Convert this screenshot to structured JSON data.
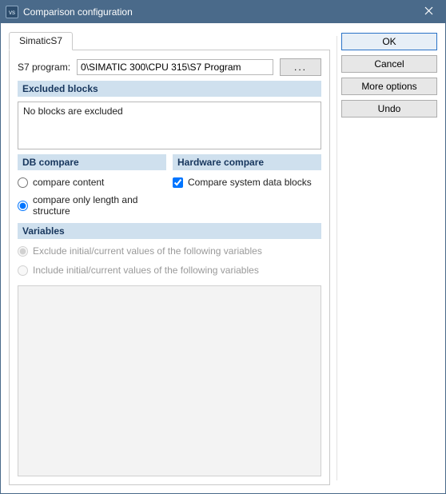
{
  "window": {
    "title": "Comparison configuration"
  },
  "buttons": {
    "ok": "OK",
    "cancel": "Cancel",
    "more_options": "More options",
    "undo": "Undo",
    "browse": "..."
  },
  "tabs": {
    "simatic": "SimaticS7"
  },
  "program": {
    "label": "S7 program:",
    "value": "0\\SIMATIC 300\\CPU 315\\S7 Program"
  },
  "sections": {
    "excluded_blocks": "Excluded blocks",
    "db_compare": "DB compare",
    "hardware_compare": "Hardware compare",
    "variables": "Variables"
  },
  "excluded_blocks_msg": "No blocks are excluded",
  "db_options": {
    "compare_content": "compare content",
    "compare_length": "compare only length and structure"
  },
  "hw_options": {
    "compare_sysdata": "Compare system data blocks"
  },
  "var_options": {
    "exclude": "Exclude initial/current values of the following variables",
    "include": "Include initial/current values of the following variables"
  }
}
